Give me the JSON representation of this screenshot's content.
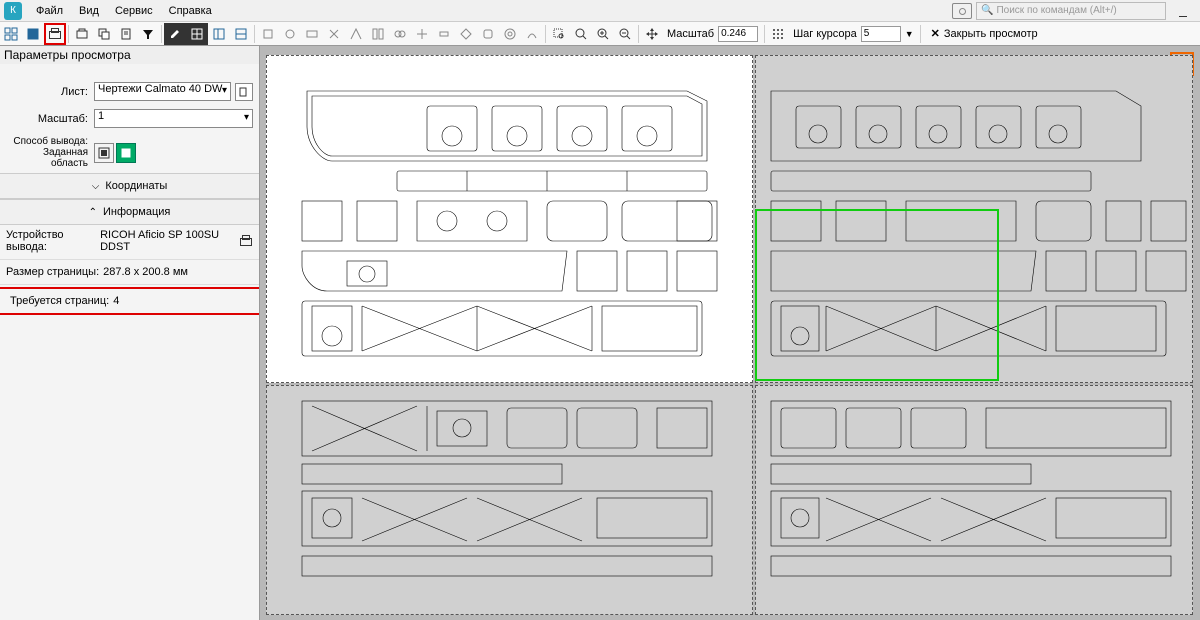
{
  "menubar": {
    "items": [
      "Файл",
      "Вид",
      "Сервис",
      "Справка"
    ],
    "search_placeholder": "Поиск по командам (Alt+/)"
  },
  "toolbar": {
    "scale_label": "Масштаб",
    "scale_value": "0.246",
    "cursor_label": "Шаг курсора",
    "cursor_value": "5",
    "close_preview": "Закрыть просмотр"
  },
  "sidebar": {
    "title": "Параметры просмотра",
    "sheet_label": "Лист:",
    "sheet_value": "Чертежи Calmato 40 DW",
    "scale_label": "Масштаб:",
    "scale_value": "1",
    "output_label": "Способ вывода:",
    "output_sub": "Заданная область",
    "coords_section": "Координаты",
    "info_section": "Информация",
    "device_label": "Устройство вывода:",
    "device_value": "RICOH Aficio SP 100SU DDST",
    "page_size_label": "Размер страницы:",
    "page_size_value": "287.8 x 200.8 мм",
    "pages_needed_label": "Требуется страниц:",
    "pages_needed_value": "4"
  },
  "icons": {
    "grid4": "grid-4-icon",
    "grid1": "grid-1-icon",
    "print": "printer-icon",
    "print_region": "print-region-icon",
    "copy": "copy-icon",
    "filter": "filter-icon",
    "pencil": "pencil-icon",
    "table": "table-icon",
    "wrench": "wrench-icon",
    "zoom_fit": "zoom-fit-icon",
    "zoom_in": "zoom-in-icon",
    "zoom_out": "zoom-out-icon",
    "pan": "pan-icon",
    "search": "search-icon",
    "close": "close-icon",
    "camera": "camera-icon"
  }
}
